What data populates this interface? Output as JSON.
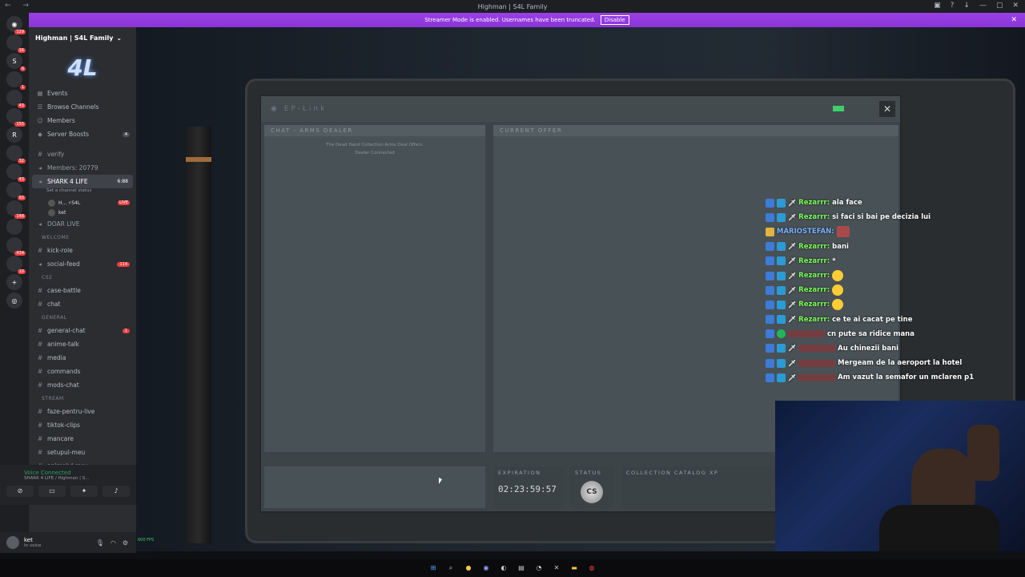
{
  "window": {
    "title": "Highman | S4L Family"
  },
  "banner": {
    "text": "Streamer Mode is enabled. Usernames have been truncated.",
    "button": "Disable"
  },
  "guild_badges": [
    "129",
    "16",
    "6",
    "1",
    "43",
    "155",
    "32",
    "43",
    "93",
    "148",
    "434",
    "10"
  ],
  "server": {
    "name": "Highman | S4L Family",
    "links": [
      "Events",
      "Browse Channels",
      "Members",
      "Server Boosts"
    ],
    "boost_count": "4"
  },
  "channels": {
    "top": [
      {
        "name": "verify"
      },
      {
        "name": "Members: 20779"
      }
    ],
    "voice_active": {
      "name": "SHARK 4 LIFE",
      "time": "6:88",
      "status": "Set a channel status",
      "users": [
        "H... ⚡S4L",
        "ket"
      ],
      "live": "LIVE"
    },
    "doar_live": "DOAR LIVE",
    "welcome_cat": "WELCOME",
    "welcome": [
      {
        "name": "kick-role"
      },
      {
        "name": "social-feed",
        "badge": "114"
      }
    ],
    "cs2_cat": "CS2",
    "cs2": [
      {
        "name": "case-battle"
      },
      {
        "name": "chat"
      }
    ],
    "general_cat": "GENERAL",
    "general": [
      {
        "name": "general-chat",
        "badge": "1"
      },
      {
        "name": "anime-talk"
      },
      {
        "name": "media"
      },
      {
        "name": "commands"
      },
      {
        "name": "mods-chat"
      }
    ],
    "stream_cat": "STREAM",
    "stream": [
      {
        "name": "faze-pentru-live"
      },
      {
        "name": "tiktok-clips"
      },
      {
        "name": "mancare"
      },
      {
        "name": "setupul-meu"
      },
      {
        "name": "animalul-meu"
      }
    ]
  },
  "voice_panel": {
    "title": "Voice Connected",
    "sub": "SHARK 4 LIFE / Highman | S..."
  },
  "user_panel": {
    "name": "ket",
    "status": "In voice"
  },
  "fps": "600 FPS",
  "game": {
    "app_title": "EP-Link",
    "chat_title": "CHAT - ARMS DEALER",
    "chat_msg1": "The Dead Hand Collection Arms Deal Offers.",
    "chat_msg2": "Dealer Connected",
    "offer_title": "CURRENT OFFER",
    "expiration_label": "EXPIRATION",
    "expiration_value": "02:23:59:57",
    "status_label": "STATUS",
    "status_logo": "CS",
    "catalog_label": "COLLECTION CATALOG XP",
    "close": "✕"
  },
  "chat": [
    {
      "name": "Rezarrr:",
      "msg": "ala face",
      "color": "green"
    },
    {
      "name": "Rezarrr:",
      "msg": "si faci si bai pe decizia lui",
      "color": "green"
    },
    {
      "name": "MARIOSTEFAN:",
      "msg": "",
      "color": "blue",
      "emote": "img",
      "crown": true
    },
    {
      "name": "Rezarrr:",
      "msg": "bani",
      "color": "green"
    },
    {
      "name": "Rezarrr:",
      "msg": "*",
      "color": "green"
    },
    {
      "name": "Rezarrr:",
      "msg": "",
      "color": "green",
      "emote": "laugh"
    },
    {
      "name": "Rezarrr:",
      "msg": "",
      "color": "green",
      "emote": "laugh"
    },
    {
      "name": "Rezarrr:",
      "msg": "",
      "color": "green",
      "emote": "laugh"
    },
    {
      "name": "Rezarrr:",
      "msg": "ce te ai cacat pe tine",
      "color": "green"
    },
    {
      "name": "",
      "msg": "cn pute sa ridice mana",
      "color": "red",
      "bot": true
    },
    {
      "name": "",
      "msg": "Au chinezii bani",
      "color": "red"
    },
    {
      "name": "",
      "msg": "Mergeam de la aeroport la hotel",
      "color": "red"
    },
    {
      "name": "",
      "msg": "Am vazut la semafor un mclaren p1",
      "color": "red"
    }
  ]
}
